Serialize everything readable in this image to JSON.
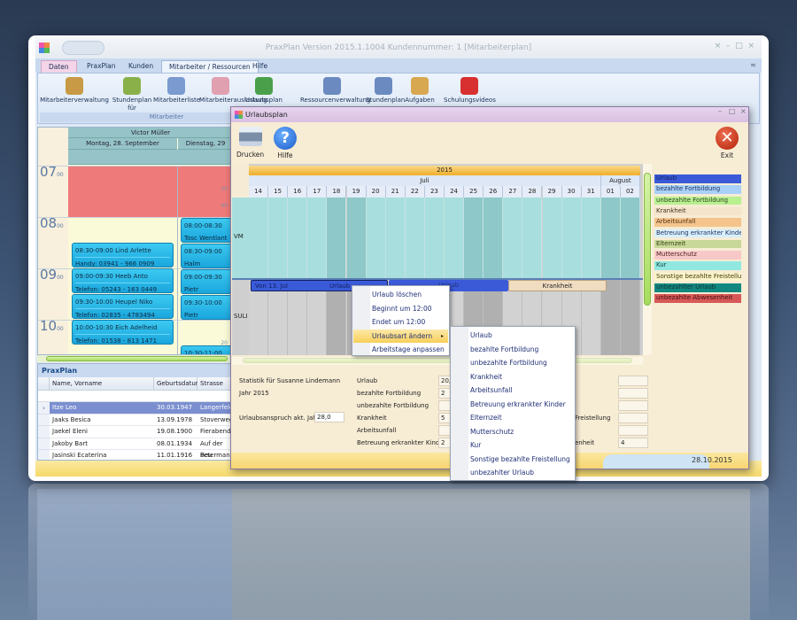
{
  "app": {
    "title": "PraxPlan Version 2015.1.1004  Kundennummer: 1  [Mitarbeiterplan]",
    "tabs": [
      "Daten",
      "PraxPlan",
      "Kunden",
      "Mitarbeiter / Ressourcen",
      "Hilfe"
    ],
    "ribbon": [
      {
        "label": "Mitarbeiterverwaltung",
        "icon": "user-icon",
        "color": "#c89a46"
      },
      {
        "label": "Stundenplan für Mitarbeiter",
        "icon": "chart-user-icon",
        "color": "#8ab04a"
      },
      {
        "label": "Mitarbeiterliste",
        "icon": "list-user-icon",
        "color": "#7a9ad0"
      },
      {
        "label": "Mitarbeiterauslastung",
        "icon": "graph-icon",
        "color": "#e0a0b0"
      },
      {
        "label": "Urlaubsplan",
        "icon": "globe-icon",
        "color": "#4aa04a"
      },
      {
        "label": "Ressourcenverwaltung",
        "icon": "hammer-icon",
        "color": "#6a8ac0"
      },
      {
        "label": "Stundenplan",
        "icon": "hammer-calendar-icon",
        "color": "#6a8ac0"
      },
      {
        "label": "Aufgaben",
        "icon": "clipboard-check-icon",
        "color": "#d8a850"
      },
      {
        "label": "Schulungsvideos",
        "icon": "film-icon",
        "color": "#d83030"
      }
    ],
    "ribbon_group": "Mitarbeiter"
  },
  "calendar": {
    "person": "Victor Müller",
    "days": [
      "Montag, 28. September",
      "Dienstag, 29"
    ],
    "hours": [
      "07",
      "08",
      "09",
      "10"
    ],
    "minutes": [
      "00",
      "20",
      "40"
    ],
    "appointments_col1": [
      {
        "line1": "08:30-09:00 Lind Arlette",
        "line2": "Handy: 03941 - 966 0909"
      },
      {
        "line1": "09:00-09:30 Heeb Anto",
        "line2": "Telefon: 05243 - 163 0449"
      },
      {
        "line1": "09:30-10:00 Heupel Niko",
        "line2": "Telefon: 02835 - 4783494"
      },
      {
        "line1": "10:00-10:30 Eich Adelheid",
        "line2": "Telefon: 01538 - 813 1471"
      }
    ],
    "appointments_col2": [
      "08:00-08:30 Tosc Wentlant",
      "08:30-09:00 Halm",
      "09:00-09:30 Pietr",
      "09:30-10:00 Pietr",
      "10:30-11:00 Maid"
    ]
  },
  "grid": {
    "title": "PraxPlan",
    "columns": [
      "Name, Vorname",
      "Geburtsdatum",
      "Strasse"
    ],
    "rows": [
      [
        "Itze Leo",
        "30.03.1947",
        "Langerfelds"
      ],
      [
        "Jaaks Besica",
        "13.09.1978",
        "Stoverweg"
      ],
      [
        "Jaekel Eleni",
        "19.08.1900",
        "Fierabendg"
      ],
      [
        "Jakoby Bart",
        "08.01.1934",
        "Auf der Beu"
      ],
      [
        "Jasinski Ecaterina",
        "11.01.1916",
        "Petermann"
      ]
    ]
  },
  "dialog": {
    "title": "Urlaubsplan",
    "print": "Drucken",
    "help": "Hilfe",
    "exit": "Exit",
    "year": "2015",
    "months": [
      "Juli",
      "August"
    ],
    "days": [
      "14",
      "15",
      "16",
      "17",
      "18",
      "19",
      "20",
      "21",
      "22",
      "23",
      "24",
      "25",
      "26",
      "27",
      "28",
      "29",
      "30",
      "31",
      "01",
      "02"
    ],
    "weekend_days": [
      "18",
      "19",
      "25",
      "26",
      "01",
      "02"
    ],
    "rows": [
      "VM",
      "SULI"
    ],
    "bars": [
      {
        "label_from": "Von 13. Jul",
        "label": "Urlaub",
        "color": "#3a5ad8"
      },
      {
        "label": "Urlaub",
        "color": "#3a5ad8"
      },
      {
        "label": "Krankheit",
        "color": "#f0dcc0"
      }
    ],
    "legend": [
      {
        "label": "Urlaub",
        "bg": "#3a5ad8",
        "fg": "#102060"
      },
      {
        "label": "bezahlte Fortbildung",
        "bg": "#a8d0f8",
        "fg": "#203060"
      },
      {
        "label": "unbezahlte Fortbildung",
        "bg": "#b8f090",
        "fg": "#304020"
      },
      {
        "label": "Krankheit",
        "bg": "#f4e4cc",
        "fg": "#403020"
      },
      {
        "label": "Arbeitsunfall",
        "bg": "#f4c48c",
        "fg": "#503010"
      },
      {
        "label": "Betreuung erkrankter  Kinder",
        "bg": "#d8f0fc",
        "fg": "#203060"
      },
      {
        "label": "Elternzeit",
        "bg": "#c8d898",
        "fg": "#304010"
      },
      {
        "label": "Mutterschutz",
        "bg": "#f8c8c8",
        "fg": "#502020"
      },
      {
        "label": "Kur",
        "bg": "#90e8e0",
        "fg": "#104040"
      },
      {
        "label": "Sonstige bezahlte  Freistellung",
        "bg": "#fcf4c8",
        "fg": "#403810"
      },
      {
        "label": "unbezahlter Urlaub",
        "bg": "#108880",
        "fg": "#103030"
      },
      {
        "label": "unbezahlte  Abwesenheit",
        "bg": "#d85858",
        "fg": "#401010"
      }
    ],
    "stats": {
      "heading": "Statistik für Susanne Lindemann",
      "year": "Jahr 2015",
      "entitlement_label": "Urlaubsanspruch akt. Jahr",
      "entitlement_value": "28,0",
      "col1": [
        {
          "label": "Urlaub",
          "value": "20,5"
        },
        {
          "label": "bezahlte Fortbildung",
          "value": "2"
        },
        {
          "label": "unbezahlte Fortbildung",
          "value": ""
        },
        {
          "label": "Krankheit",
          "value": "5"
        },
        {
          "label": "Arbeitsunfall",
          "value": ""
        },
        {
          "label": "Betreuung erkrankter Kinder",
          "value": "2"
        }
      ],
      "col2": [
        {
          "label": "",
          "value": ""
        },
        {
          "label": "",
          "value": ""
        },
        {
          "label": "",
          "value": ""
        },
        {
          "label": "Freistellung",
          "value": ""
        },
        {
          "label": "",
          "value": ""
        },
        {
          "label": "enheit",
          "value": "4"
        }
      ]
    },
    "date": "28.10.2015"
  },
  "context_menu": [
    "Urlaub löschen",
    "Beginnt um 12:00",
    "Endet um 12:00",
    "Urlaubsart ändern",
    "Arbeitstage anpassen"
  ],
  "submenu": [
    "Urlaub",
    "bezahlte Fortbildung",
    "unbezahlte Fortbildung",
    "Krankheit",
    "Arbeitsunfall",
    "Betreuung erkrankter Kinder",
    "Elternzeit",
    "Mutterschutz",
    "Kur",
    "Sonstige bezahlte Freistellung",
    "unbezahlter Urlaub"
  ]
}
